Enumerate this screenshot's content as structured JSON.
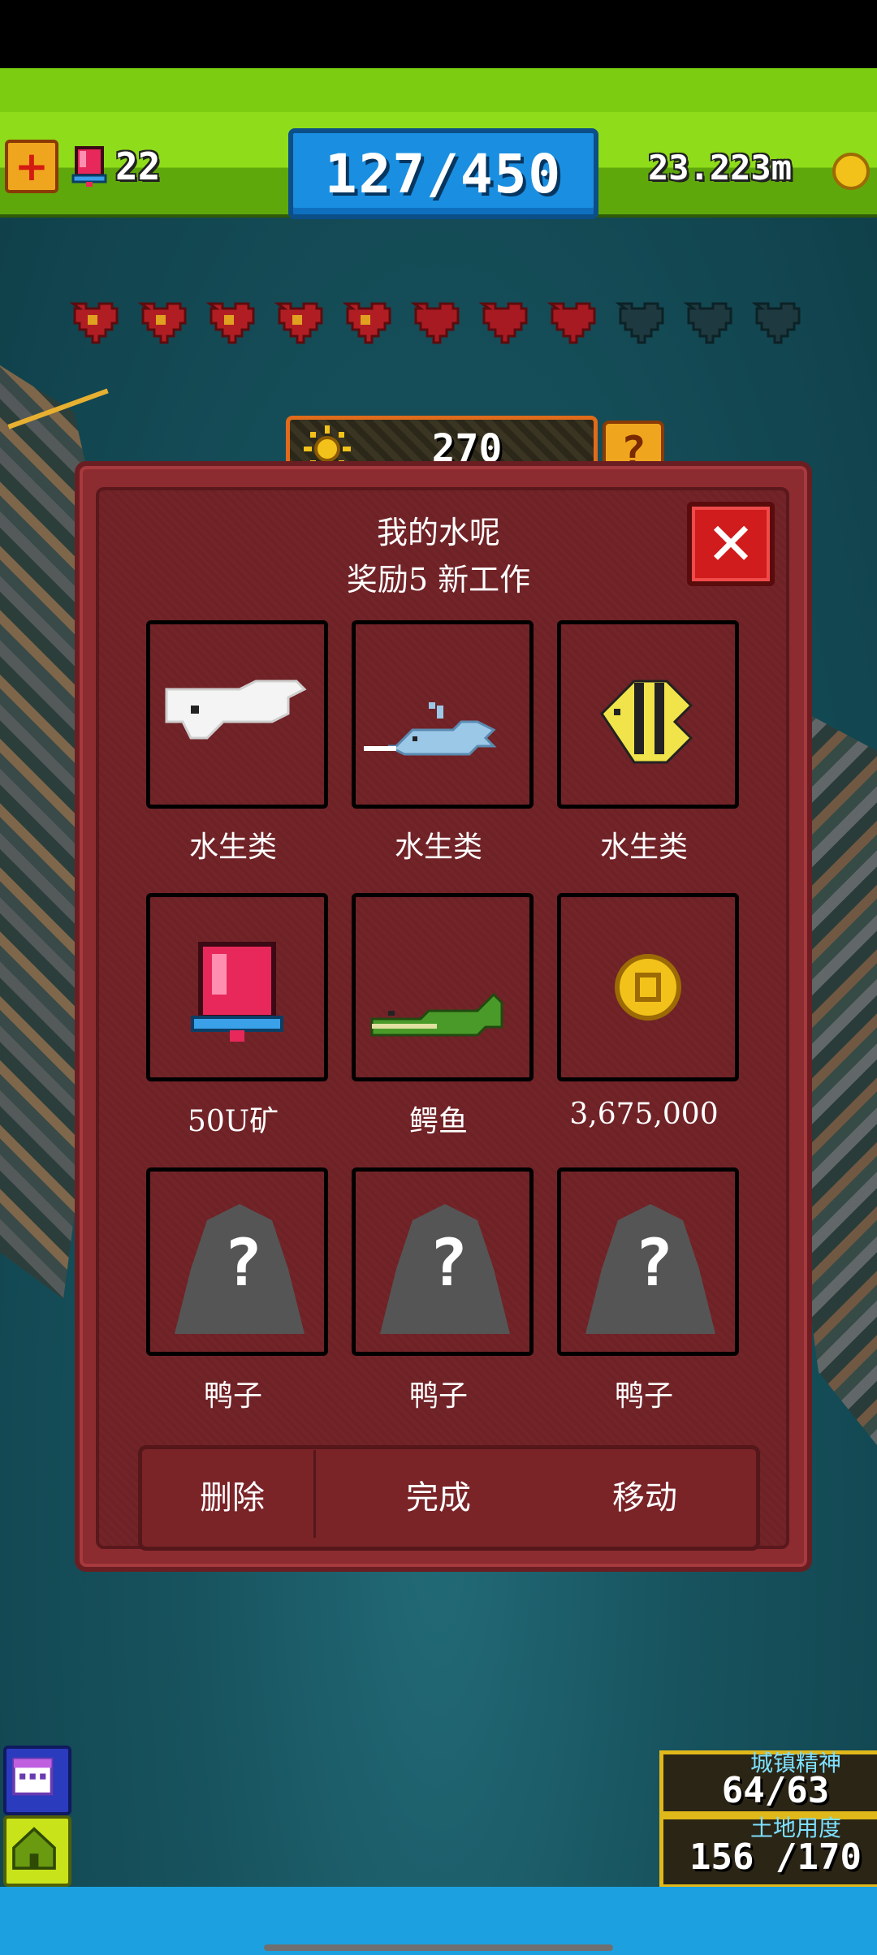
{
  "hud": {
    "alarm_count": "22",
    "population": "127/450",
    "money": "23.223m"
  },
  "hearts": {
    "filled": 5,
    "red": 3,
    "empty": 3
  },
  "score": "270",
  "dialog": {
    "title": "我的水呢",
    "subtitle": "奖励5 新工作",
    "rewards": [
      {
        "label": "水生类",
        "icon": "white-whale-icon",
        "tile": "yellow"
      },
      {
        "label": "水生类",
        "icon": "narwhal-icon",
        "tile": "teal"
      },
      {
        "label": "水生类",
        "icon": "striped-fish-icon",
        "tile": "yellow"
      },
      {
        "label": "50U矿",
        "icon": "alarm-icon",
        "tile": "gray"
      },
      {
        "label": "鳄鱼",
        "icon": "crocodile-icon",
        "tile": "yellow"
      },
      {
        "label": "3,675,000",
        "icon": "coin-icon",
        "tile": "teal"
      },
      {
        "label": "鸭子",
        "icon": "mystery-icon",
        "tile": "gray"
      },
      {
        "label": "鸭子",
        "icon": "mystery-icon",
        "tile": "gray"
      },
      {
        "label": "鸭子",
        "icon": "mystery-icon",
        "tile": "gray"
      }
    ],
    "actions": {
      "delete": "删除",
      "complete": "完成",
      "move": "移动"
    }
  },
  "stats": {
    "spirit_label": "城镇精神",
    "spirit_value": "64/63",
    "land_label": "土地用度",
    "land_value": "156 /170"
  },
  "colors": {
    "hud_green": "#8fdc1a",
    "dialog_red": "#8d2c30",
    "population_blue": "#1a8ee0",
    "close_red": "#d01c1c"
  }
}
